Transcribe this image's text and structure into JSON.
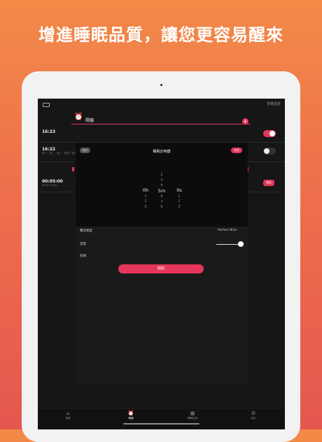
{
  "headline": "增進睡眠品質，讓您更容易醒來",
  "status": {
    "right_text": "背景設定"
  },
  "header": {
    "title": "鬧鐘"
  },
  "alarms": [
    {
      "time": "16:23",
      "sub": "",
      "enabled": true
    },
    {
      "time": "16:22",
      "sub": "週一，週二，週三，週四，週五",
      "enabled": false
    }
  ],
  "timer_row": {
    "time": "00:05:00",
    "sub": "Perfect Bliss",
    "action": "開始"
  },
  "dialog": {
    "title": "睡眠計時器",
    "cancel": "取消",
    "done": "完成",
    "hours": {
      "above": [],
      "selected": "0",
      "below": [
        "1",
        "2",
        "3"
      ],
      "unit": "h"
    },
    "minutes": {
      "above": [
        "2",
        "3",
        "4"
      ],
      "selected": "5",
      "below": [
        "6",
        "7",
        "8"
      ],
      "unit": "m"
    },
    "seconds": {
      "above": [],
      "selected": "0",
      "below": [
        "1",
        "2",
        "3"
      ],
      "unit": "s"
    }
  },
  "settings": {
    "sound_type_label": "聲音類型",
    "sound_type_value": "Perfect Bliss",
    "volume_label": "音量",
    "volume_level": 0.9,
    "name_label": "名稱"
  },
  "start_button": "開始",
  "tabs": [
    {
      "label": "首頁",
      "icon": "home-icon",
      "glyph": "⌂",
      "active": false
    },
    {
      "label": "鬧鐘",
      "icon": "alarm-icon",
      "glyph": "⏰",
      "active": true
    },
    {
      "label": "睡眠記錄",
      "icon": "sleep-record-icon",
      "glyph": "▦",
      "active": false
    },
    {
      "label": "設定",
      "icon": "settings-icon",
      "glyph": "⚙",
      "active": false
    }
  ],
  "colors": {
    "accent": "#e6365a",
    "bg_top": "#f28a47",
    "bg_bottom": "#e4574f"
  }
}
